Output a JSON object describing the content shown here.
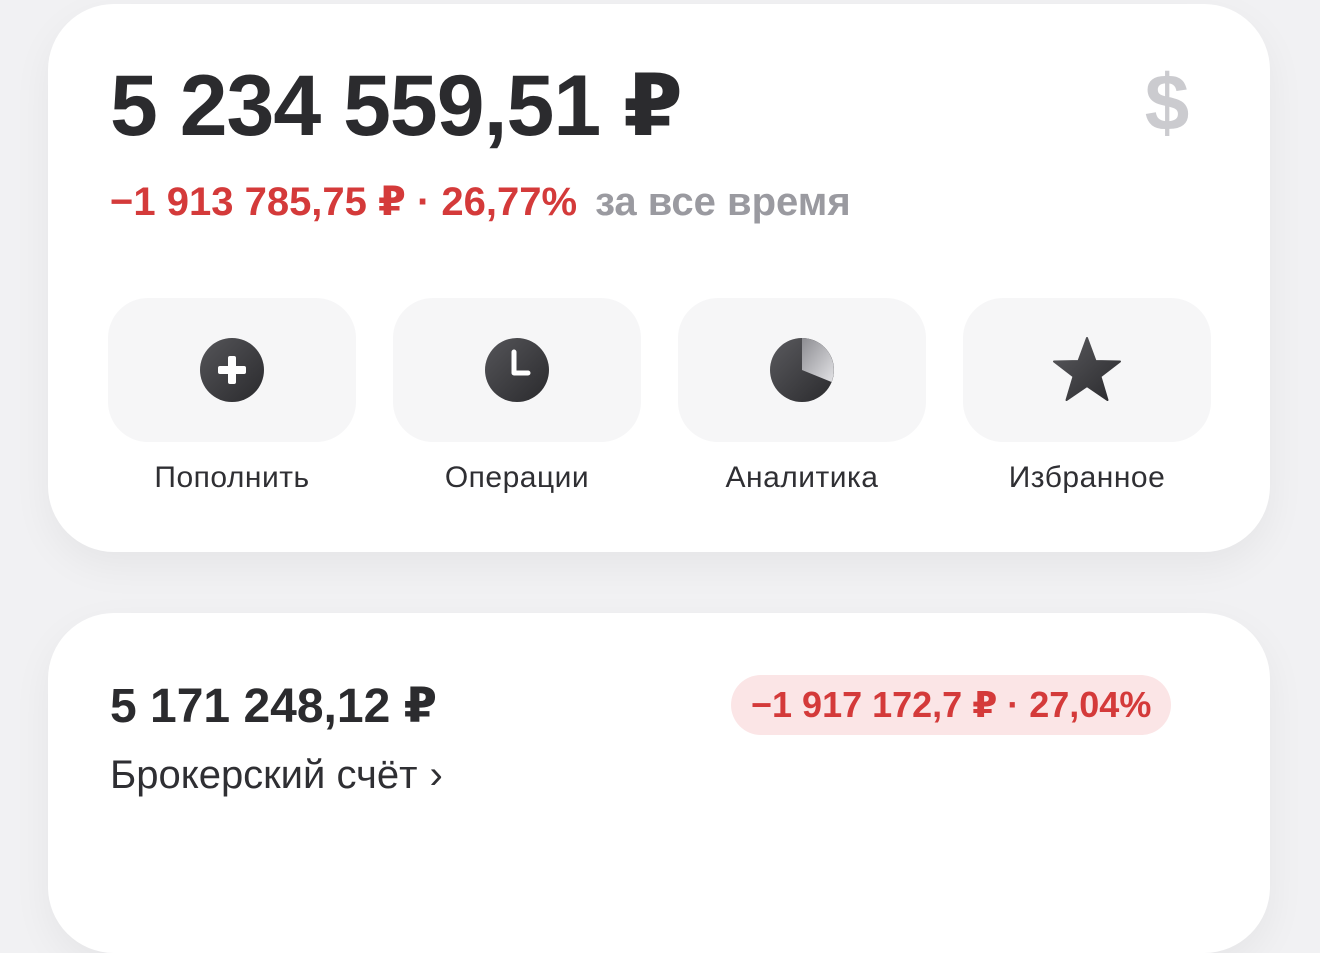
{
  "portfolio": {
    "total": "5 234 559,51 ₽",
    "currency_icon": "$",
    "change_value": "−1 913 785,75 ₽ · 26,77%",
    "change_period": "за все время",
    "negative_color": "#d43a3a"
  },
  "actions": [
    {
      "label": "Пополнить",
      "icon": "plus-circle-icon"
    },
    {
      "label": "Операции",
      "icon": "clock-icon"
    },
    {
      "label": "Аналитика",
      "icon": "pie-chart-icon"
    },
    {
      "label": "Избранное",
      "icon": "star-icon"
    }
  ],
  "account": {
    "amount": "5 171 248,12 ₽",
    "name": "Брокерский счёт",
    "chevron": "›",
    "change": "−1 917 172,7 ₽ · 27,04%"
  }
}
